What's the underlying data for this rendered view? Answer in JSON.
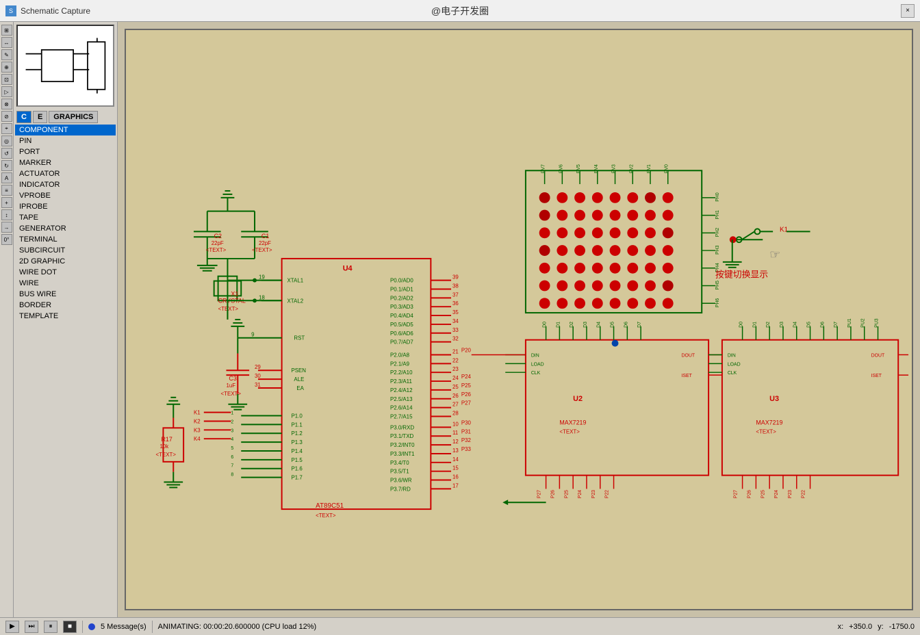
{
  "titlebar": {
    "title": "Schematic Capture",
    "close": "×",
    "center": "@电子开发圈"
  },
  "tabs": [
    {
      "id": "c",
      "label": "C",
      "active": true
    },
    {
      "id": "e",
      "label": "E",
      "active": false
    },
    {
      "id": "graphics",
      "label": "GRAPHICS",
      "active": false
    }
  ],
  "sidebar": {
    "section": "COMPONENT",
    "items": [
      {
        "label": "COMPONENT",
        "active": true
      },
      {
        "label": "PIN",
        "active": false
      },
      {
        "label": "PORT",
        "active": false
      },
      {
        "label": "MARKER",
        "active": false
      },
      {
        "label": "ACTUATOR",
        "active": false
      },
      {
        "label": "INDICATOR",
        "active": false
      },
      {
        "label": "VPROBE",
        "active": false
      },
      {
        "label": "IPROBE",
        "active": false
      },
      {
        "label": "TAPE",
        "active": false
      },
      {
        "label": "GENERATOR",
        "active": false
      },
      {
        "label": "TERMINAL",
        "active": false
      },
      {
        "label": "SUBCIRCUIT",
        "active": false
      },
      {
        "label": "2D GRAPHIC",
        "active": false
      },
      {
        "label": "WIRE DOT",
        "active": false
      },
      {
        "label": "WIRE",
        "active": false
      },
      {
        "label": "BUS WIRE",
        "active": false
      },
      {
        "label": "BORDER",
        "active": false
      },
      {
        "label": "TEMPLATE",
        "active": false
      }
    ]
  },
  "schematic": {
    "crystal_label": "CRYSTAL",
    "c2_label": "C2",
    "c2_val": "22pF",
    "c1_label": "C1",
    "c1_val": "22pF",
    "x1_label": "X1",
    "u4_label": "U4",
    "u4_type": "AT89C51",
    "c3_label": "C3",
    "c3_val": "1uF",
    "r17_label": "R17",
    "r17_val": "10k",
    "u2_label": "U2",
    "u2_type": "MAX7219",
    "u3_label": "U3",
    "u3_type": "MAX7219",
    "k1_label": "K1",
    "switch_text": "按键切换显示",
    "text_placeholder": "<TEXT>"
  },
  "statusbar": {
    "messages": "5 Message(s)",
    "animating": "ANIMATING: 00:00:20.600000 (CPU load 12%)",
    "x_label": "x:",
    "x_val": "+350.0",
    "y_label": "y:",
    "y_val": "-1750.0"
  },
  "toolbar_icons": [
    "⊞",
    "⊡",
    "▷",
    "⊕",
    "⌖",
    "✎",
    "⚡",
    "⊗",
    "⊘",
    "↔",
    "↕",
    "◎",
    "⊞",
    "⊡",
    "⊕",
    "⊖",
    "↺",
    "↻",
    "⊛",
    "↔",
    "→"
  ]
}
